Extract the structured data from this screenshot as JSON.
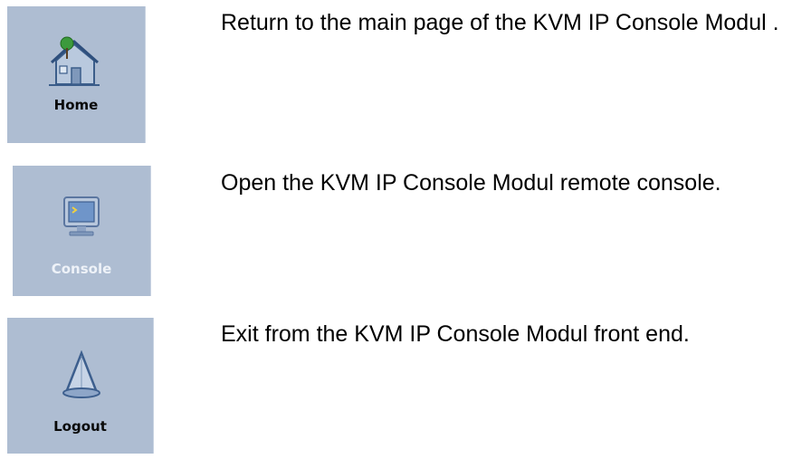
{
  "items": [
    {
      "button_label": "Home",
      "icon": "home-icon",
      "description": "  Return to the main page of the KVM IP Console Modul ."
    },
    {
      "button_label": "Console",
      "icon": "monitor-icon",
      "description": "  Open the KVM IP Console Modul remote console."
    },
    {
      "button_label": "Logout",
      "icon": "logout-icon",
      "description": "  Exit from the KVM IP Console Modul front end."
    }
  ],
  "colors": {
    "tile_background": "#aebdd2",
    "home_label": "#0a0a0a",
    "console_label": "#eef2f8",
    "logout_label": "#0a0a0a"
  }
}
